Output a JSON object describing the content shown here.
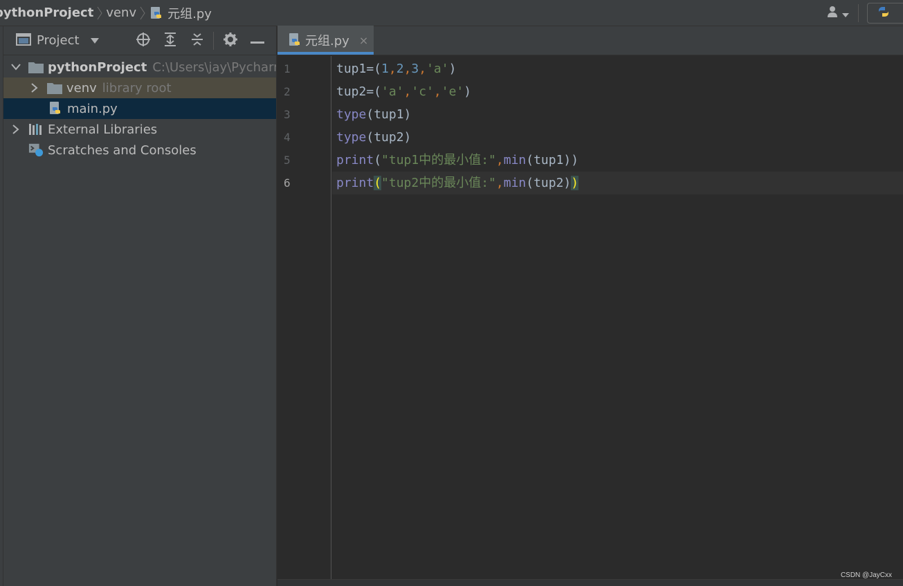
{
  "navbar": {
    "project": "pythonProject",
    "folder": "venv",
    "file": "元组.py"
  },
  "project_panel": {
    "title": "Project",
    "tree": {
      "root_label": "pythonProject",
      "root_path": "C:\\Users\\jay\\PycharmP",
      "venv_label": "venv",
      "venv_hint": "library root",
      "main_label": "main.py",
      "external_label": "External Libraries",
      "scratches_label": "Scratches and Consoles"
    }
  },
  "editor": {
    "tab_label": "元组.py",
    "tab_close": "×",
    "current_line": 6,
    "line_numbers": [
      "1",
      "2",
      "3",
      "4",
      "5",
      "6"
    ],
    "code": {
      "l1": {
        "a": "tup1=(",
        "n1": "1",
        "c1": ",",
        "n2": "2",
        "c2": ",",
        "n3": "3",
        "c3": ",",
        "s1": "'a'",
        "e": ")"
      },
      "l2": {
        "a": "tup2=(",
        "s1": "'a'",
        "c1": ",",
        "s2": "'c'",
        "c2": ",",
        "s3": "'e'",
        "e": ")"
      },
      "l3": {
        "fn": "type",
        "rest": "(tup1)"
      },
      "l4": {
        "fn": "type",
        "rest": "(tup2)"
      },
      "l5": {
        "fn": "print",
        "open": "(",
        "str": "\"tup1中的最小值:\"",
        "comma": ",",
        "fn2": "min",
        "rest": "(tup1))"
      },
      "l6": {
        "fn": "print",
        "open": "(",
        "str": "\"tup2中的最小值:\"",
        "comma": ",",
        "fn2": "min",
        "rest": "(tup2)",
        "close": ")"
      }
    }
  },
  "watermark": "CSDN @JayCxx",
  "colors": {
    "background": "#2b2b2b",
    "panel": "#3c3f41",
    "selection": "#0d293e",
    "accent": "#4a88c7",
    "keyword_builtin": "#8888c6",
    "string": "#6a8759",
    "number": "#6897bb"
  },
  "icons": [
    "user-icon",
    "python-icon",
    "window-icon",
    "locate-icon",
    "expand-all-icon",
    "collapse-all-icon",
    "gear-icon",
    "minimize-icon",
    "folder-icon",
    "library-icon",
    "scratches-icon"
  ]
}
